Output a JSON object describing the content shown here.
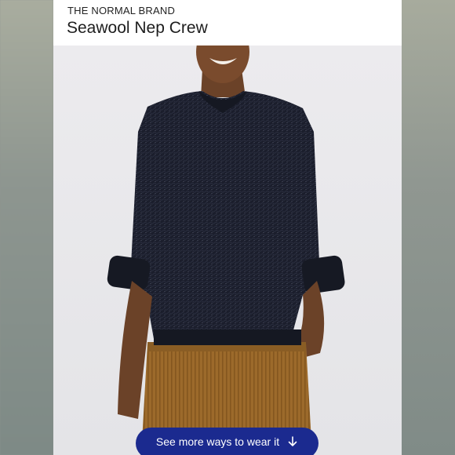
{
  "product": {
    "brand": "THE NORMAL BRAND",
    "title": "Seawool Nep Crew"
  },
  "cta": {
    "label": "See more ways to wear it",
    "icon": "arrow-down-icon"
  },
  "colors": {
    "cta_background": "#1b2a8f",
    "sweater": "#1a1d2a",
    "pants": "#9a6a2c"
  }
}
